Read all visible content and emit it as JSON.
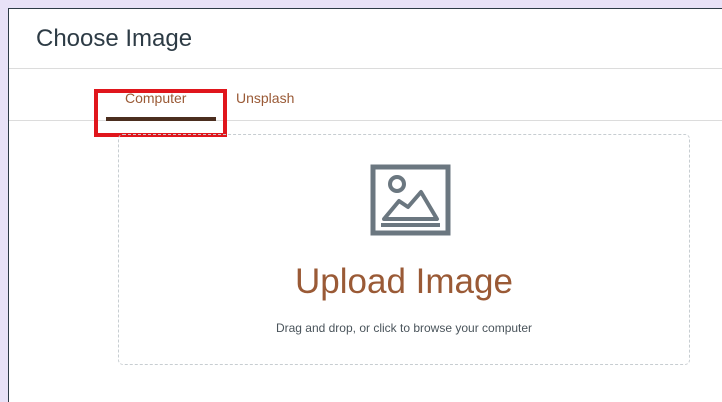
{
  "dialog": {
    "title": "Choose Image"
  },
  "tabs": [
    {
      "label": "Computer",
      "selected": true
    },
    {
      "label": "Unsplash",
      "selected": false
    }
  ],
  "dropzone": {
    "icon": "image-icon",
    "title": "Upload Image",
    "subtitle": "Drag and drop, or click to browse your computer"
  },
  "colors": {
    "accent": "#9a5a36",
    "selected_tab_underline": "#4b2e1f",
    "highlight": "#e0161c",
    "icon": "#6b7780",
    "text_dark": "#2d3b45"
  }
}
